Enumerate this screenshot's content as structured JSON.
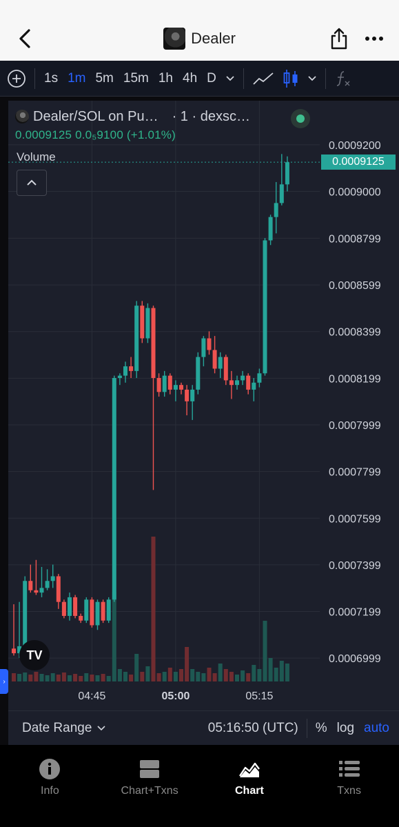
{
  "header": {
    "title": "Dealer",
    "back_icon": "chevron-left-icon",
    "share_icon": "share-icon",
    "more_icon": "more-horizontal-icon"
  },
  "toolbar": {
    "add_icon": "plus-circle-icon",
    "intervals": [
      "1s",
      "1m",
      "5m",
      "15m",
      "1h",
      "4h",
      "D"
    ],
    "active_interval": "1m",
    "chevron_icon": "chevron-down-icon",
    "line_icon": "line-chart-icon",
    "candle_icon": "candles-icon",
    "indicator_icon": "fx-icon"
  },
  "legend": {
    "symbol": "Dealer/SOL on Pu…",
    "interval": "· 1 · dexsc…",
    "ohlc": "0.0009125  0.0₅9100 (+1.01%)",
    "volume_label": "Volume"
  },
  "chart_data": {
    "type": "candlestick",
    "price_axis": [
      "0.0009200",
      "0.0009000",
      "0.0008799",
      "0.0008599",
      "0.0008399",
      "0.0008199",
      "0.0007999",
      "0.0007799",
      "0.0007599",
      "0.0007399",
      "0.0007199",
      "0.0006999"
    ],
    "time_axis": [
      "04:45",
      "05:00",
      "05:15"
    ],
    "last_price": "0.0009125",
    "ylim": [
      0.0006899,
      0.00093
    ],
    "colors": {
      "up": "#26a69a",
      "down": "#ef5350",
      "grid": "#2a2e39",
      "bg": "#1c1f2b"
    },
    "candles": [
      {
        "o": 0.000704,
        "h": 0.000723,
        "l": 0.000701,
        "c": 0.000702
      },
      {
        "o": 0.000702,
        "h": 0.000724,
        "l": 0.0007,
        "c": 0.000705
      },
      {
        "o": 0.000705,
        "h": 0.000735,
        "l": 0.000704,
        "c": 0.000733
      },
      {
        "o": 0.000733,
        "h": 0.00074,
        "l": 0.000728,
        "c": 0.000729
      },
      {
        "o": 0.000729,
        "h": 0.000742,
        "l": 0.000727,
        "c": 0.000728
      },
      {
        "o": 0.000728,
        "h": 0.000739,
        "l": 0.000726,
        "c": 0.00073
      },
      {
        "o": 0.00073,
        "h": 0.000738,
        "l": 0.000729,
        "c": 0.000733
      },
      {
        "o": 0.000733,
        "h": 0.00074,
        "l": 0.00073,
        "c": 0.000735
      },
      {
        "o": 0.000735,
        "h": 0.000736,
        "l": 0.000721,
        "c": 0.000724
      },
      {
        "o": 0.000724,
        "h": 0.000725,
        "l": 0.000717,
        "c": 0.000718
      },
      {
        "o": 0.000718,
        "h": 0.000728,
        "l": 0.000716,
        "c": 0.000726
      },
      {
        "o": 0.000726,
        "h": 0.000727,
        "l": 0.000717,
        "c": 0.000718
      },
      {
        "o": 0.000718,
        "h": 0.000719,
        "l": 0.000715,
        "c": 0.000716
      },
      {
        "o": 0.000716,
        "h": 0.000726,
        "l": 0.000715,
        "c": 0.000725
      },
      {
        "o": 0.000725,
        "h": 0.000726,
        "l": 0.000713,
        "c": 0.000714
      },
      {
        "o": 0.000714,
        "h": 0.000725,
        "l": 0.000712,
        "c": 0.000724
      },
      {
        "o": 0.000724,
        "h": 0.000725,
        "l": 0.000715,
        "c": 0.000716
      },
      {
        "o": 0.000716,
        "h": 0.000726,
        "l": 0.000715,
        "c": 0.000725
      },
      {
        "o": 0.000725,
        "h": 0.000821,
        "l": 0.000724,
        "c": 0.00082
      },
      {
        "o": 0.00082,
        "h": 0.000822,
        "l": 0.000817,
        "c": 0.000821
      },
      {
        "o": 0.000821,
        "h": 0.000827,
        "l": 0.000818,
        "c": 0.000825
      },
      {
        "o": 0.000825,
        "h": 0.000829,
        "l": 0.00082,
        "c": 0.000823
      },
      {
        "o": 0.000823,
        "h": 0.000853,
        "l": 0.00082,
        "c": 0.000851
      },
      {
        "o": 0.000851,
        "h": 0.000853,
        "l": 0.000835,
        "c": 0.000837
      },
      {
        "o": 0.000837,
        "h": 0.000852,
        "l": 0.000835,
        "c": 0.00085
      },
      {
        "o": 0.00085,
        "h": 0.000851,
        "l": 0.000772,
        "c": 0.00082
      },
      {
        "o": 0.00082,
        "h": 0.000822,
        "l": 0.000812,
        "c": 0.000814
      },
      {
        "o": 0.000814,
        "h": 0.000823,
        "l": 0.000812,
        "c": 0.000821
      },
      {
        "o": 0.000821,
        "h": 0.000822,
        "l": 0.000813,
        "c": 0.000815
      },
      {
        "o": 0.000815,
        "h": 0.000819,
        "l": 0.00081,
        "c": 0.000817
      },
      {
        "o": 0.000817,
        "h": 0.000818,
        "l": 0.000813,
        "c": 0.000815
      },
      {
        "o": 0.000815,
        "h": 0.000817,
        "l": 0.000804,
        "c": 0.00081
      },
      {
        "o": 0.00081,
        "h": 0.000817,
        "l": 0.000802,
        "c": 0.000815
      },
      {
        "o": 0.000815,
        "h": 0.000831,
        "l": 0.000813,
        "c": 0.000829
      },
      {
        "o": 0.000829,
        "h": 0.000838,
        "l": 0.000825,
        "c": 0.000837
      },
      {
        "o": 0.000837,
        "h": 0.00084,
        "l": 0.00083,
        "c": 0.000832
      },
      {
        "o": 0.000832,
        "h": 0.000838,
        "l": 0.000822,
        "c": 0.000824
      },
      {
        "o": 0.000824,
        "h": 0.000831,
        "l": 0.00082,
        "c": 0.000829
      },
      {
        "o": 0.000829,
        "h": 0.00083,
        "l": 0.000817,
        "c": 0.000819
      },
      {
        "o": 0.000819,
        "h": 0.000823,
        "l": 0.000811,
        "c": 0.000817
      },
      {
        "o": 0.000817,
        "h": 0.000821,
        "l": 0.000815,
        "c": 0.000819
      },
      {
        "o": 0.000819,
        "h": 0.000823,
        "l": 0.000817,
        "c": 0.000821
      },
      {
        "o": 0.000821,
        "h": 0.000822,
        "l": 0.000813,
        "c": 0.000815
      },
      {
        "o": 0.000815,
        "h": 0.00082,
        "l": 0.00081,
        "c": 0.000818
      },
      {
        "o": 0.000818,
        "h": 0.000824,
        "l": 0.000816,
        "c": 0.000822
      },
      {
        "o": 0.000822,
        "h": 0.00088,
        "l": 0.000821,
        "c": 0.000879
      },
      {
        "o": 0.000879,
        "h": 0.00089,
        "l": 0.000877,
        "c": 0.000889
      },
      {
        "o": 0.000889,
        "h": 0.000904,
        "l": 0.000882,
        "c": 0.000895
      },
      {
        "o": 0.000895,
        "h": 0.000916,
        "l": 0.000894,
        "c": 0.000903
      },
      {
        "o": 0.000903,
        "h": 0.000915,
        "l": 0.0009,
        "c": 0.0009125
      }
    ],
    "volumes": [
      12,
      11,
      13,
      10,
      14,
      11,
      9,
      12,
      10,
      13,
      9,
      11,
      8,
      12,
      10,
      9,
      11,
      8,
      130,
      18,
      14,
      10,
      40,
      14,
      22,
      210,
      12,
      14,
      20,
      14,
      18,
      50,
      18,
      14,
      12,
      20,
      12,
      26,
      18,
      14,
      10,
      16,
      12,
      24,
      18,
      88,
      34,
      20,
      30,
      26
    ]
  },
  "chart_footer": {
    "date_range": "Date Range",
    "clock": "05:16:50 (UTC)",
    "percent": "%",
    "log": "log",
    "auto": "auto"
  },
  "bottom_nav": {
    "items": [
      {
        "label": "Info",
        "icon": "info-icon"
      },
      {
        "label": "Chart+Txns",
        "icon": "split-view-icon"
      },
      {
        "label": "Chart",
        "icon": "area-chart-icon"
      },
      {
        "label": "Txns",
        "icon": "list-icon"
      }
    ],
    "active": "Chart"
  }
}
